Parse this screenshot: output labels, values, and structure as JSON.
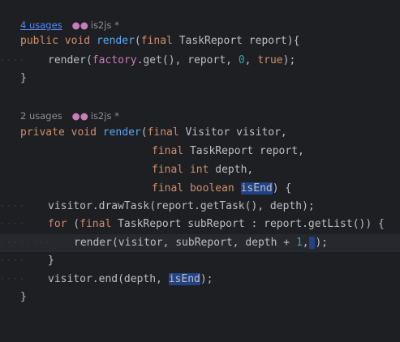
{
  "editor": {
    "inlay1": {
      "usages": "4 usages",
      "author": "is2js *"
    },
    "inlay2": {
      "usages": "2 usages",
      "author": "is2js *"
    },
    "lines": {
      "l1": {
        "kw1": "public",
        "kw2": "void",
        "name": "render",
        "p1": "(",
        "kw3": "final",
        "rest": " TaskReport report){"
      },
      "l2": {
        "name": "render",
        "p1": "(",
        "fld": "factory",
        "rest1": ".get(), report, ",
        "n0": "0",
        "rest2": ", ",
        "kw": "true",
        "rest3": ");"
      },
      "l3": {
        "text": "}"
      },
      "l5": {
        "kw1": "private",
        "kw2": "void",
        "name": "render",
        "p1": "(",
        "kw3": "final",
        "rest": " Visitor visitor,"
      },
      "l6": {
        "kw": "final",
        "rest": " TaskReport report,"
      },
      "l7": {
        "kw": "final",
        "kw2": "int",
        "rest": " depth,"
      },
      "l8": {
        "kw": "final",
        "kw2": "boolean",
        "param": "isEnd",
        "rest": ") {"
      },
      "l9": {
        "text": "visitor.drawTask(report.getTask(), depth);"
      },
      "l10": {
        "kw": "for",
        "p1": " (",
        "kw2": "final",
        "rest": " TaskReport subReport : report.getList()) {"
      },
      "l11": {
        "name": "render",
        "rest1": "(visitor, subReport, depth + ",
        "n1": "1",
        "rest2": ",",
        "rest3": ");"
      },
      "l12": {
        "text": "}"
      },
      "l13": {
        "text1": "visitor.end(depth, ",
        "param": "isEnd",
        "text2": ");"
      },
      "l14": {
        "text": "}"
      }
    }
  }
}
